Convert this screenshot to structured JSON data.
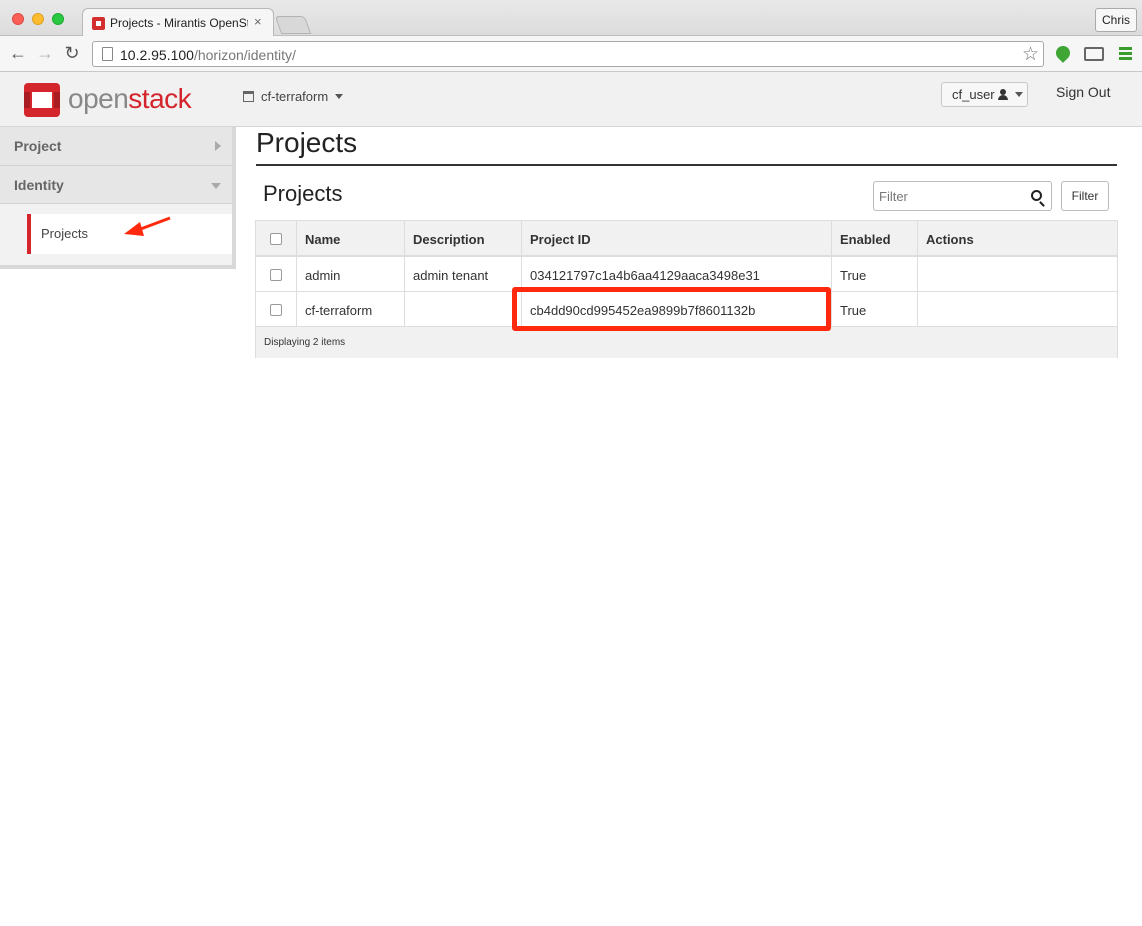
{
  "browser": {
    "tab_title": "Projects - Mirantis OpenStack",
    "tab_close": "×",
    "profile_name": "Chris",
    "url_host": "10.2.95.100",
    "url_path": "/horizon/identity/",
    "back_glyph": "←",
    "forward_glyph": "→",
    "reload_glyph": "↻",
    "star_glyph": "☆"
  },
  "header": {
    "logo_open": "open",
    "logo_stack": "stack",
    "project_selector": "cf-terraform",
    "user": "cf_user",
    "sign_out": "Sign Out",
    "brand_color": "#d4242c"
  },
  "sidebar": {
    "panels": [
      {
        "label": "Project",
        "expanded": false
      },
      {
        "label": "Identity",
        "expanded": true
      }
    ],
    "identity_items": [
      {
        "label": "Projects",
        "active": true
      }
    ]
  },
  "main": {
    "page_title": "Projects",
    "section_title": "Projects",
    "filter_placeholder": "Filter",
    "filter_button": "Filter",
    "table": {
      "columns": [
        "Name",
        "Description",
        "Project ID",
        "Enabled",
        "Actions"
      ],
      "rows": [
        {
          "name": "admin",
          "description": "admin tenant",
          "project_id": "034121797c1a4b6aa4129aaca3498e31",
          "enabled": "True",
          "actions": ""
        },
        {
          "name": "cf-terraform",
          "description": "",
          "project_id": "cb4dd90cd995452ea9899b7f8601132b",
          "enabled": "True",
          "actions": ""
        }
      ],
      "footer": "Displaying 2 items"
    },
    "highlight_color": "#ff2a0e"
  }
}
